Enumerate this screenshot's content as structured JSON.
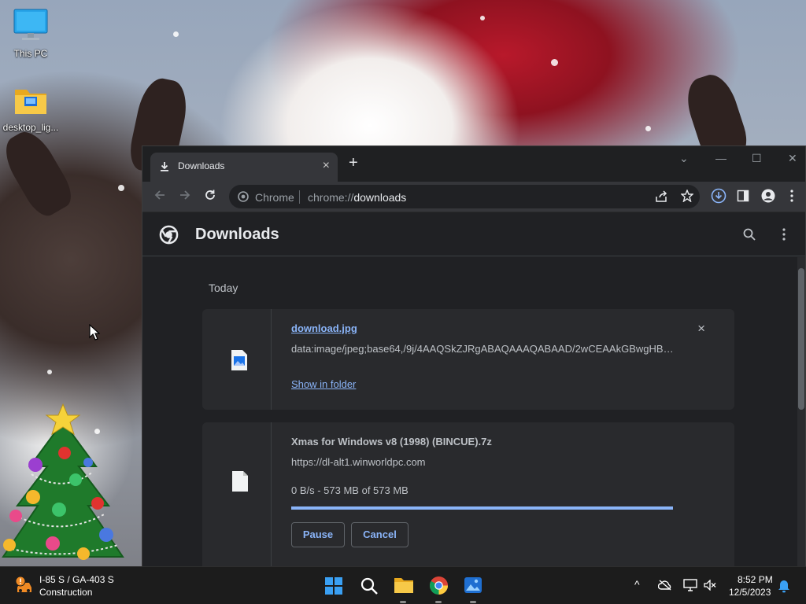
{
  "desktop": {
    "icons": [
      {
        "label": "This PC",
        "icon": "this-pc-icon"
      },
      {
        "label": "desktop_lig...",
        "icon": "folder-icon"
      }
    ]
  },
  "browser": {
    "tab": {
      "title": "Downloads",
      "icon": "download-icon",
      "close": "×"
    },
    "new_tab": "+",
    "window_controls": {
      "tab_search": "⌄",
      "minimize": "—",
      "maximize": "☐",
      "close": "✕"
    },
    "omnibox": {
      "site": "Chrome",
      "url_prefix": "chrome://",
      "url_main": "downloads"
    },
    "page": {
      "title": "Downloads",
      "group_label": "Today",
      "items": [
        {
          "filename": "download.jpg",
          "source": "data:image/jpeg;base64,/9j/4AAQSkZJRgABAQAAAQABAAD/2wCEAAkGBwgHBgkI...",
          "action": "Show in folder",
          "remove": "×",
          "file_icon": "image-file-icon"
        },
        {
          "filename": "Xmas for Windows v8 (1998) (BINCUE).7z",
          "source": "https://dl-alt1.winworldpc.com",
          "status": "0 B/s - 573 MB of 573 MB",
          "progress": 1.0,
          "pause_label": "Pause",
          "cancel_label": "Cancel",
          "file_icon": "generic-file-icon"
        }
      ]
    }
  },
  "taskbar": {
    "widget": {
      "title": "I-85 S / GA-403 S",
      "subtitle": "Construction",
      "icon": "traffic-warning-icon"
    },
    "apps": [
      "start-icon",
      "search-icon",
      "file-explorer-icon",
      "chrome-icon",
      "photos-icon"
    ],
    "tray": {
      "chevron": "^",
      "time": "8:52 PM",
      "date": "12/5/2023"
    }
  },
  "colors": {
    "accent": "#8ab4f8",
    "page_bg": "#202124",
    "card_bg": "#292a2d",
    "toolbar_bg": "#35363a",
    "taskbar_bg": "#1c1c1c",
    "download_icon_blue": "#8ab4f8"
  }
}
